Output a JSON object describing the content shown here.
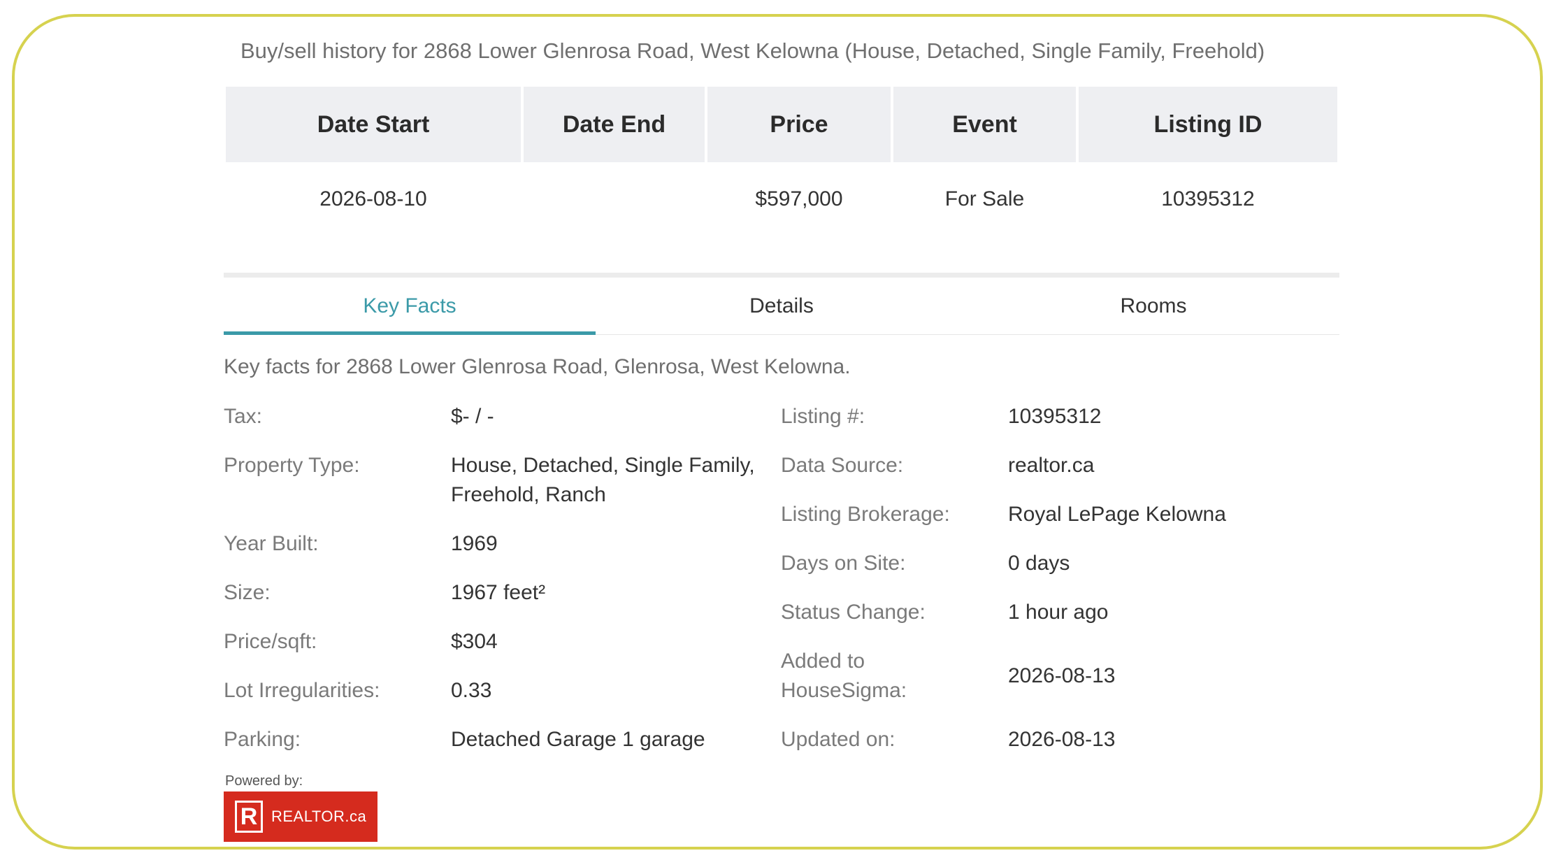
{
  "history": {
    "title": "Buy/sell history for 2868 Lower Glenrosa Road, West Kelowna (House, Detached, Single Family, Freehold)",
    "columns": [
      "Date Start",
      "Date End",
      "Price",
      "Event",
      "Listing ID"
    ],
    "rows": [
      [
        "2026-08-10",
        "",
        "$597,000",
        "For Sale",
        "10395312"
      ]
    ]
  },
  "tabs": [
    "Key Facts",
    "Details",
    "Rooms"
  ],
  "active_tab": "Key Facts",
  "facts": {
    "title": "Key facts for 2868 Lower Glenrosa Road, Glenrosa, West Kelowna.",
    "left": [
      {
        "label": "Tax:",
        "value": "$- / -"
      },
      {
        "label": "Property Type:",
        "value": "House, Detached, Single Family, Freehold, Ranch"
      },
      {
        "label": "Year Built:",
        "value": "1969"
      },
      {
        "label": "Size:",
        "value": "1967 feet²"
      },
      {
        "label": "Price/sqft:",
        "value": "$304"
      },
      {
        "label": "Lot Irregularities:",
        "value": "0.33"
      },
      {
        "label": "Parking:",
        "value": "Detached Garage 1 garage"
      }
    ],
    "right": [
      {
        "label": "Listing #:",
        "value": "10395312"
      },
      {
        "label": "Data Source:",
        "value": "realtor.ca"
      },
      {
        "label": "Listing Brokerage:",
        "value": "Royal LePage Kelowna"
      },
      {
        "label": "Days on Site:",
        "value": "0 days"
      },
      {
        "label": "Status Change:",
        "value": "1 hour ago"
      },
      {
        "label": "Added to HouseSigma:",
        "value": "2026-08-13"
      },
      {
        "label": "Updated on:",
        "value": "2026-08-13"
      }
    ]
  },
  "footer": {
    "powered_by": "Powered by:",
    "logo_text": "REALTOR.ca",
    "logo_mark": "R",
    "logo_color": "#d52b1e"
  },
  "colors": {
    "accent": "#3b9aa8",
    "frame": "#d6d24f"
  }
}
